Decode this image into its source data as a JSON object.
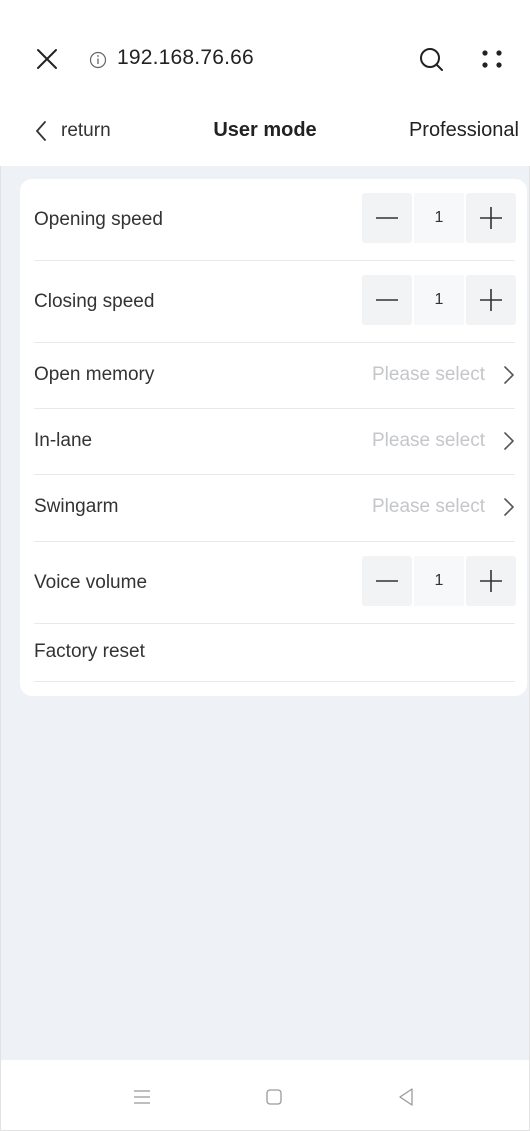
{
  "browser": {
    "url": "192.168.76.66"
  },
  "header": {
    "back_label": "return",
    "title": "User mode",
    "mode_link": "Professional"
  },
  "settings": {
    "opening_speed": {
      "label": "Opening speed",
      "value": "1"
    },
    "closing_speed": {
      "label": "Closing speed",
      "value": "1"
    },
    "open_memory": {
      "label": "Open memory",
      "placeholder": "Please select"
    },
    "in_lane": {
      "label": "In-lane",
      "placeholder": "Please select"
    },
    "swingarm": {
      "label": "Swingarm",
      "placeholder": "Please select"
    },
    "voice_volume": {
      "label": "Voice volume",
      "value": "1"
    },
    "factory_reset": {
      "label": "Factory reset"
    }
  },
  "icons": {
    "browser": [
      "close-icon",
      "info-icon",
      "search-icon",
      "more-icon"
    ],
    "nav": [
      "menu-icon",
      "home-icon",
      "back-icon"
    ]
  },
  "colors": {
    "background": "#eef1f5",
    "card": "#ffffff",
    "placeholder": "#c4c6c9",
    "stepper_button": "#f1f3f5"
  }
}
